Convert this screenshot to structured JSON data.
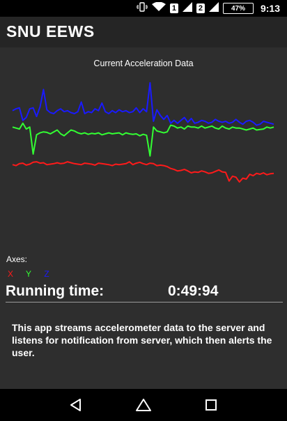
{
  "status_bar": {
    "icons": [
      "vibrate-icon",
      "wifi-icon",
      "sim1-signal-icon",
      "sim2-signal-icon",
      "battery-charging-icon"
    ],
    "sim1_label": "1",
    "sim2_label": "2",
    "battery": "47%",
    "time": "9:13"
  },
  "app": {
    "title": "SNU EEWS"
  },
  "chart": {
    "title": "Current Acceleration Data"
  },
  "chart_data": {
    "type": "line",
    "title": "Current Acceleration Data",
    "xlabel": "",
    "ylabel": "",
    "grid": false,
    "legend": "bottom-left",
    "series": [
      {
        "name": "X",
        "color": "#ff1a1a",
        "values": [
          0.3,
          0.2,
          0.4,
          0.45,
          0.25,
          0.35,
          0.55,
          0.6,
          0.45,
          0.5,
          0.3,
          0.35,
          0.4,
          0.5,
          0.4,
          0.45,
          0.6,
          0.5,
          0.4,
          0.35,
          0.3,
          0.45,
          0.4,
          0.35,
          0.25,
          0.45,
          0.4,
          0.35,
          0.3,
          0.2,
          0.35,
          0.3,
          0.35,
          0.4,
          0.6,
          0.3,
          0.45,
          0.55,
          0.4,
          0.3,
          0.45,
          0.4,
          0.2,
          0.25,
          0.2,
          0.1,
          -0.1,
          -0.2,
          -0.35,
          -0.3,
          -0.2,
          -0.35,
          -0.55,
          -0.45,
          -0.5,
          -0.35,
          -0.45,
          -0.6,
          -0.55,
          -0.4,
          -0.25,
          -0.45,
          -0.5,
          -1.4,
          -0.9,
          -1.0,
          -1.5,
          -1.1,
          -1.2,
          -0.7,
          -0.85,
          -0.6,
          -0.7,
          -0.55,
          -0.75,
          -0.65,
          -0.6
        ]
      },
      {
        "name": "Y",
        "color": "#33ff33",
        "values": [
          4.2,
          4.1,
          4.0,
          4.6,
          4.0,
          4.2,
          1.4,
          3.4,
          3.6,
          3.7,
          3.65,
          3.5,
          3.7,
          3.9,
          3.5,
          3.3,
          3.6,
          3.9,
          3.8,
          3.6,
          3.5,
          3.6,
          3.45,
          3.55,
          3.5,
          3.6,
          3.4,
          3.5,
          3.6,
          3.5,
          3.55,
          3.6,
          3.4,
          3.6,
          3.5,
          3.45,
          3.5,
          3.3,
          3.45,
          3.35,
          1.2,
          4.2,
          3.8,
          3.7,
          3.6,
          3.7,
          4.4,
          4.3,
          4.1,
          4.2,
          4.0,
          4.3,
          4.2,
          4.2,
          4.1,
          4.3,
          4.1,
          4.2,
          4.3,
          4.1,
          4.0,
          4.3,
          4.1,
          4.0,
          4.2,
          4.1,
          4.1,
          4.0,
          3.9,
          4.0,
          4.1,
          3.9,
          3.95,
          4.0,
          4.2,
          4.1,
          4.2
        ]
      },
      {
        "name": "Z",
        "color": "#1a1aff",
        "values": [
          5.9,
          6.1,
          6.2,
          4.9,
          5.2,
          6.1,
          6.2,
          5.3,
          6.3,
          8.1,
          6.0,
          5.7,
          5.6,
          5.9,
          6.1,
          5.8,
          5.9,
          5.7,
          5.6,
          5.8,
          6.8,
          5.6,
          5.8,
          5.7,
          6.1,
          5.9,
          6.7,
          5.8,
          5.6,
          5.9,
          5.7,
          6.0,
          5.8,
          5.9,
          5.7,
          5.8,
          6.2,
          5.7,
          6.1,
          5.8,
          8.8,
          4.8,
          6.0,
          5.4,
          5.0,
          5.4,
          4.6,
          4.9,
          4.6,
          4.9,
          5.2,
          4.7,
          5.1,
          4.6,
          4.7,
          4.9,
          4.8,
          4.6,
          4.7,
          5.0,
          4.8,
          4.7,
          4.8,
          4.6,
          4.7,
          5.0,
          4.7,
          4.5,
          4.8,
          4.9,
          4.7,
          4.4,
          4.5,
          4.8,
          4.7,
          4.6,
          4.5
        ]
      }
    ]
  },
  "axes": {
    "label": "Axes:",
    "legend": [
      {
        "label": "X",
        "color": "#ff1a1a"
      },
      {
        "label": "Y",
        "color": "#33ff33"
      },
      {
        "label": "Z",
        "color": "#1a1aff"
      }
    ]
  },
  "running": {
    "label": "Running time:",
    "value": "0:49:94"
  },
  "description": "This app streams accelerometer data to the server and listens for notification from server, which then alerts the user.",
  "nav": {
    "icons": [
      "back-icon",
      "home-icon",
      "recents-icon"
    ]
  }
}
